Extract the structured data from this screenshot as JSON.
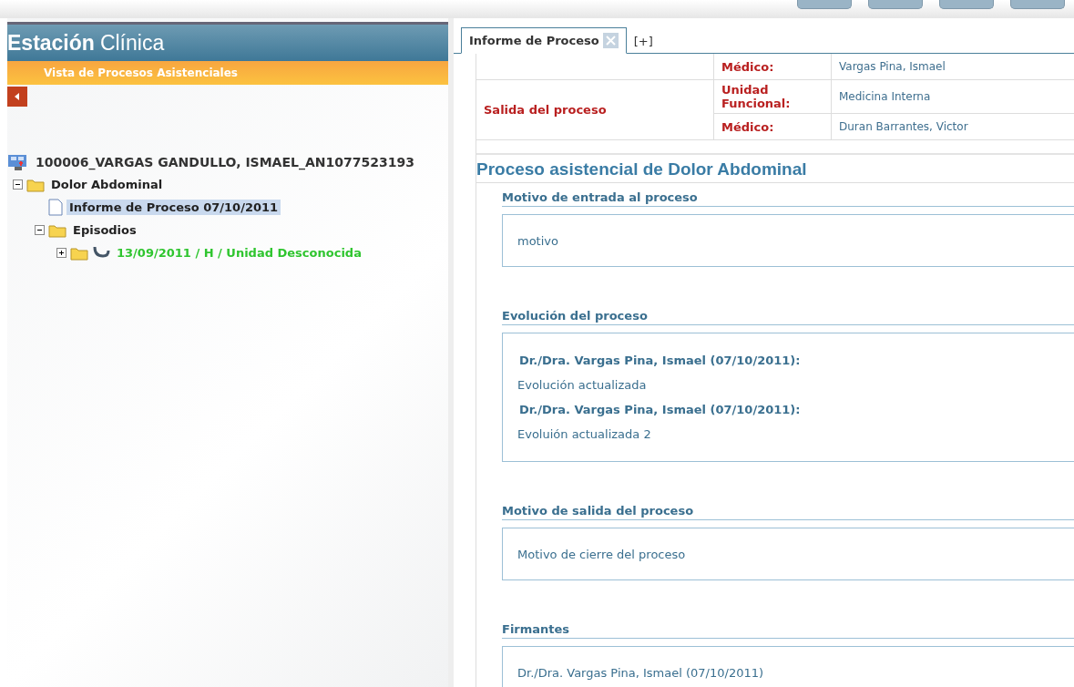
{
  "app": {
    "title_bold": "Estación",
    "title_rest": "Clínica",
    "subtitle": "Vista de Procesos Asistenciales"
  },
  "tree": [
    {
      "kind": "patient",
      "label": "100006_VARGAS GANDULLO, ISMAEL_AN1077523193",
      "selected": false,
      "children": [
        {
          "kind": "folder",
          "label": "Dolor Abdominal",
          "expanded": true,
          "selected": false,
          "children": [
            {
              "kind": "document",
              "label": "Informe de Proceso 07/10/2011",
              "selected": true
            },
            {
              "kind": "folder",
              "label": "Episodios",
              "expanded": true,
              "selected": false,
              "children": [
                {
                  "kind": "episode",
                  "label": "13/09/2011 / H / Unidad Desconocida",
                  "expanded": false,
                  "selected": false
                }
              ]
            }
          ]
        }
      ]
    }
  ],
  "tabs": [
    {
      "label": "Informe de Proceso",
      "selected": true,
      "closable": true
    },
    {
      "label": "[+]",
      "selected": false,
      "closable": false
    }
  ],
  "summary_table": {
    "rows": [
      {
        "group": "",
        "label": "Médico:",
        "value": "Vargas Pina, Ismael"
      },
      {
        "group": "Salida del proceso",
        "label": "Unidad Funcional:",
        "value": "Medicina Interna"
      },
      {
        "group": "",
        "label": "Médico:",
        "value": "Duran Barrantes, Victor"
      }
    ]
  },
  "report": {
    "title": "Proceso asistencial de Dolor Abdominal",
    "sections": [
      {
        "title": "Motivo de entrada al proceso",
        "entries": [
          {
            "kind": "text",
            "text": "motivo"
          }
        ]
      },
      {
        "title": "Evolución del proceso",
        "entries": [
          {
            "kind": "author",
            "text": "Dr./Dra. Vargas Pina, Ismael (07/10/2011):"
          },
          {
            "kind": "text",
            "text": "Evolución actualizada"
          },
          {
            "kind": "author",
            "text": "Dr./Dra. Vargas Pina, Ismael (07/10/2011):"
          },
          {
            "kind": "text",
            "text": "Evoluión actualizada 2"
          }
        ]
      },
      {
        "title": "Motivo de salida del proceso",
        "entries": [
          {
            "kind": "text",
            "text": "Motivo de cierre del proceso"
          }
        ]
      },
      {
        "title": "Firmantes",
        "entries": [
          {
            "kind": "text",
            "text": "Dr./Dra. Vargas Pina, Ismael (07/10/2011)"
          }
        ]
      }
    ]
  }
}
